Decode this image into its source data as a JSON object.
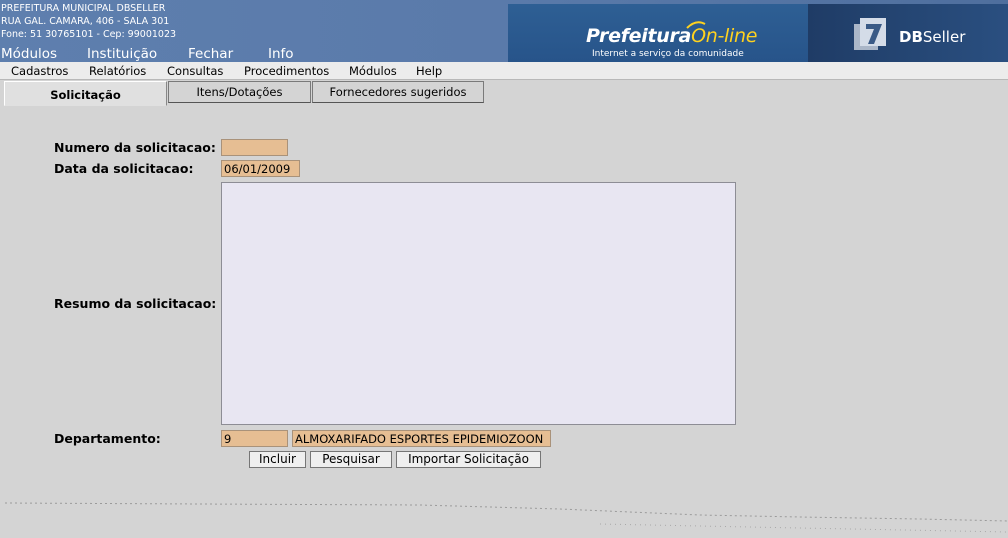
{
  "header": {
    "institution_lines": [
      "PREFEITURA MUNICIPAL DBSELLER",
      "RUA GAL. CAMARA, 406 - SALA 301",
      "Fone: 51 30765101  -  Cep: 99001023"
    ],
    "top_menu": [
      "Módulos",
      "Instituição",
      "Fechar",
      "Info"
    ],
    "banner_title_a": "Prefeitura",
    "banner_title_b": "On-line",
    "banner_subtitle": "Internet a serviço da comunidade",
    "seller_name_a": "DB",
    "seller_name_b": "Seller"
  },
  "menubar": [
    "Cadastros",
    "Relatórios",
    "Consultas",
    "Procedimentos",
    "Módulos",
    "Help"
  ],
  "tabs": [
    "Solicitação",
    "Itens/Dotações",
    "Fornecedores sugeridos"
  ],
  "form": {
    "numero_label": "Numero da solicitacao:",
    "numero_value": "",
    "data_label": "Data da solicitacao:",
    "data_value": "06/01/2009",
    "resumo_label": "Resumo da solicitacao:",
    "resumo_value": "",
    "departamento_label": "Departamento:",
    "departamento_code": "9",
    "departamento_name": "ALMOXARIFADO ESPORTES EPIDEMIOZOON"
  },
  "buttons": {
    "incluir": "Incluir",
    "pesquisar": "Pesquisar",
    "importar": "Importar Solicitação"
  },
  "colors": {
    "header_bg": "#5a7aaa",
    "field_bg": "#e6be93",
    "banner_accent": "#ffd21f"
  }
}
